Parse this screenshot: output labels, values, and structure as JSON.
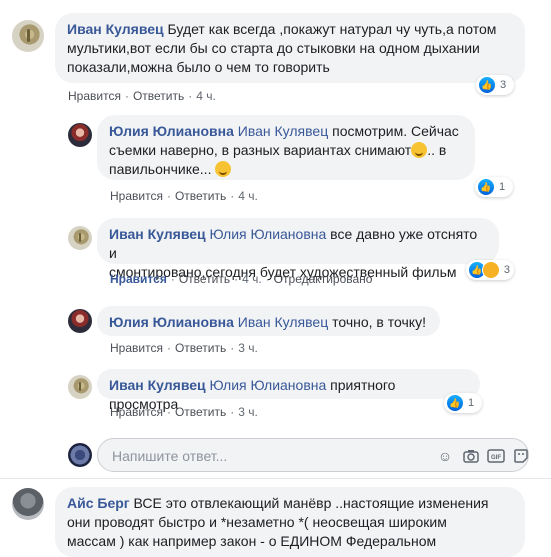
{
  "comments": [
    {
      "author": "Иван Кулявец",
      "text_line1": "Будет как всегда ,покажут натурал чу чуть,а потом",
      "text_line2": "мультики,вот если бы со старта до стыковки на одном дыхании",
      "text_line3": "показали,можна было о чем то говорить",
      "like": "Нравится",
      "reply": "Ответить",
      "time": "4 ч.",
      "reaction_count": "3"
    },
    {
      "author": "Юлия Юлиановна",
      "mention": "Иван Кулявец",
      "text_line1": "посмотрим. Сейчас",
      "text_line2": "съемки наверно, в разных вариантах снимают",
      "text_line2_tail": ".. в",
      "text_line3": "павильончике...",
      "like": "Нравится",
      "reply": "Ответить",
      "time": "4 ч.",
      "reaction_count": "1"
    },
    {
      "author": "Иван Кулявец",
      "mention": "Юлия Юлиановна",
      "text_line1": "все давно уже отснято и",
      "text_line2": "смонтировано,сегодня будет художественный фильм",
      "like": "Нравится",
      "reply": "Ответить",
      "time": "4 ч.",
      "edited": "Отредактировано",
      "reaction_count": "3"
    },
    {
      "author": "Юлия Юлиановна",
      "mention": "Иван Кулявец",
      "text_line1": "точно, в точку!",
      "like": "Нравится",
      "reply": "Ответить",
      "time": "3 ч."
    },
    {
      "author": "Иван Кулявец",
      "mention": "Юлия Юлиановна",
      "text_line1": "приятного просмотра",
      "like": "Нравится",
      "reply": "Ответить",
      "time": "3 ч.",
      "reaction_count": "1"
    },
    {
      "author": "Айс Берг",
      "text_line1": "ВСЕ это отвлекающий манёвр ..настоящие изменения",
      "text_line2": "они проводят быстро и *незаметно *( неосвещая широким",
      "text_line3": "массам ) как например закон - о ЕДИНОМ Федеральном"
    }
  ],
  "reply_box": {
    "placeholder": "Напишите ответ..."
  },
  "icons": [
    "emoji-icon",
    "camera-icon",
    "gif-icon",
    "sticker-icon"
  ],
  "colors": {
    "author": "#385898",
    "bubble": "#f2f3f5",
    "meta": "#606770",
    "like_blue": "#0062df"
  }
}
